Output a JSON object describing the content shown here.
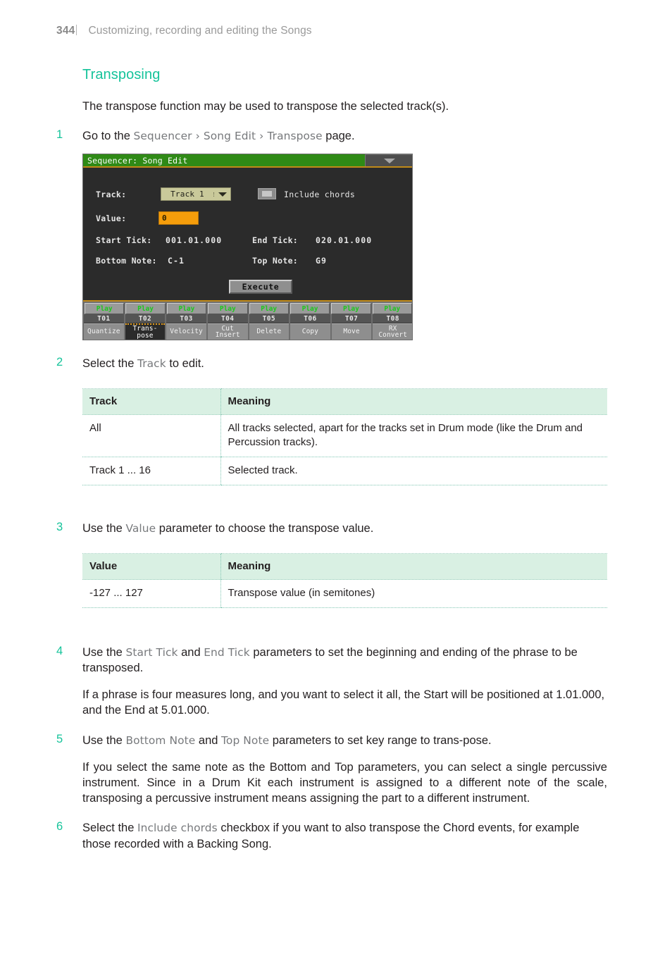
{
  "running_head": {
    "page_number": "344",
    "chapter_title": "Customizing, recording and editing the Songs"
  },
  "section": {
    "title": "Transposing",
    "intro": "The transpose function may be used to transpose the selected track(s)."
  },
  "steps": {
    "s1": {
      "num": "1",
      "text_before": "Go to the ",
      "param1": "Sequencer",
      "sep1": " › ",
      "param2": "Song Edit",
      "sep2": " › ",
      "param3": "Transpose",
      "text_after": " page."
    },
    "s2": {
      "num": "2",
      "text_before": "Select the ",
      "param1": "Track",
      "text_after": " to edit."
    },
    "s3": {
      "num": "3",
      "text_before": "Use the ",
      "param1": "Value",
      "text_after": " parameter to choose the transpose value."
    },
    "s4": {
      "num": "4",
      "text_before": "Use the ",
      "param1": "Start Tick",
      "mid": " and ",
      "param2": "End Tick",
      "text_after": " parameters to set the beginning and ending of the phrase to be transposed.",
      "note": "If a phrase is four measures long, and you want to select it all, the Start will be positioned at 1.01.000, and the End at 5.01.000."
    },
    "s5": {
      "num": "5",
      "text_before": "Use the ",
      "param1": "Bottom Note",
      "mid": " and ",
      "param2": "Top Note",
      "text_after": " parameters to set key range to trans-pose.",
      "note": "If you select the same note as the Bottom and Top parameters, you can select a single percussive instrument. Since in a Drum Kit each instrument is assigned to a different note of the scale, transposing a percussive instrument means assigning the part to a different instrument."
    },
    "s6": {
      "num": "6",
      "text_before": "Select the ",
      "param1": "Include chords",
      "text_after": " checkbox if you want to also transpose the Chord events, for example those recorded with a Backing Song."
    }
  },
  "device_screenshot": {
    "title": "Sequencer: Song Edit",
    "menu_icon": "chevron-down-icon",
    "track_label": "Track:",
    "track_value": "Track 1",
    "track_dropdown_icon": "chevron-down-icon",
    "include_chords_label": "Include chords",
    "include_chords_checked": false,
    "value_label": "Value:",
    "value_value": "0",
    "start_tick_label": "Start Tick:",
    "start_tick_value": "001.01.000",
    "end_tick_label": "End Tick:",
    "end_tick_value": "020.01.000",
    "bottom_note_label": "Bottom Note:",
    "bottom_note_value": "C-1",
    "top_note_label": "Top Note:",
    "top_note_value": "G9",
    "execute_label": "Execute",
    "play_label": "Play",
    "tracks": [
      "T01",
      "T02",
      "T03",
      "T04",
      "T05",
      "T06",
      "T07",
      "T08"
    ],
    "tabs": [
      {
        "line1": "Quantize",
        "line2": "",
        "selected": false
      },
      {
        "line1": "Trans-",
        "line2": "pose",
        "selected": true
      },
      {
        "line1": "Velocity",
        "line2": "",
        "selected": false
      },
      {
        "line1": "Cut",
        "line2": "Insert",
        "selected": false
      },
      {
        "line1": "Delete",
        "line2": "",
        "selected": false
      },
      {
        "line1": "Copy",
        "line2": "",
        "selected": false
      },
      {
        "line1": "Move",
        "line2": "",
        "selected": false
      },
      {
        "line1": "RX",
        "line2": "Convert",
        "selected": false
      }
    ],
    "colors": {
      "titlebar_green": "#2f8a16",
      "accent_orange": "#c08a18",
      "value_field": "#f59d0b",
      "combo_khaki": "#c9c99a",
      "play_green": "#1ec81e"
    }
  },
  "table_track": {
    "headers": [
      "Track",
      "Meaning"
    ],
    "rows": [
      [
        "All",
        "All tracks selected, apart for the tracks set in Drum mode (like the Drum and Percussion tracks)."
      ],
      [
        "Track 1 ... 16",
        "Selected track."
      ]
    ]
  },
  "table_value": {
    "headers": [
      "Value",
      "Meaning"
    ],
    "rows": [
      [
        "-127 ... 127",
        "Transpose value (in semitones)"
      ]
    ]
  },
  "colors": {
    "accent_teal": "#15c39a",
    "table_header_bg": "#d9f0e3",
    "table_border": "#7fc6b2",
    "body_text": "#231f20",
    "param_text": "#77797c"
  }
}
